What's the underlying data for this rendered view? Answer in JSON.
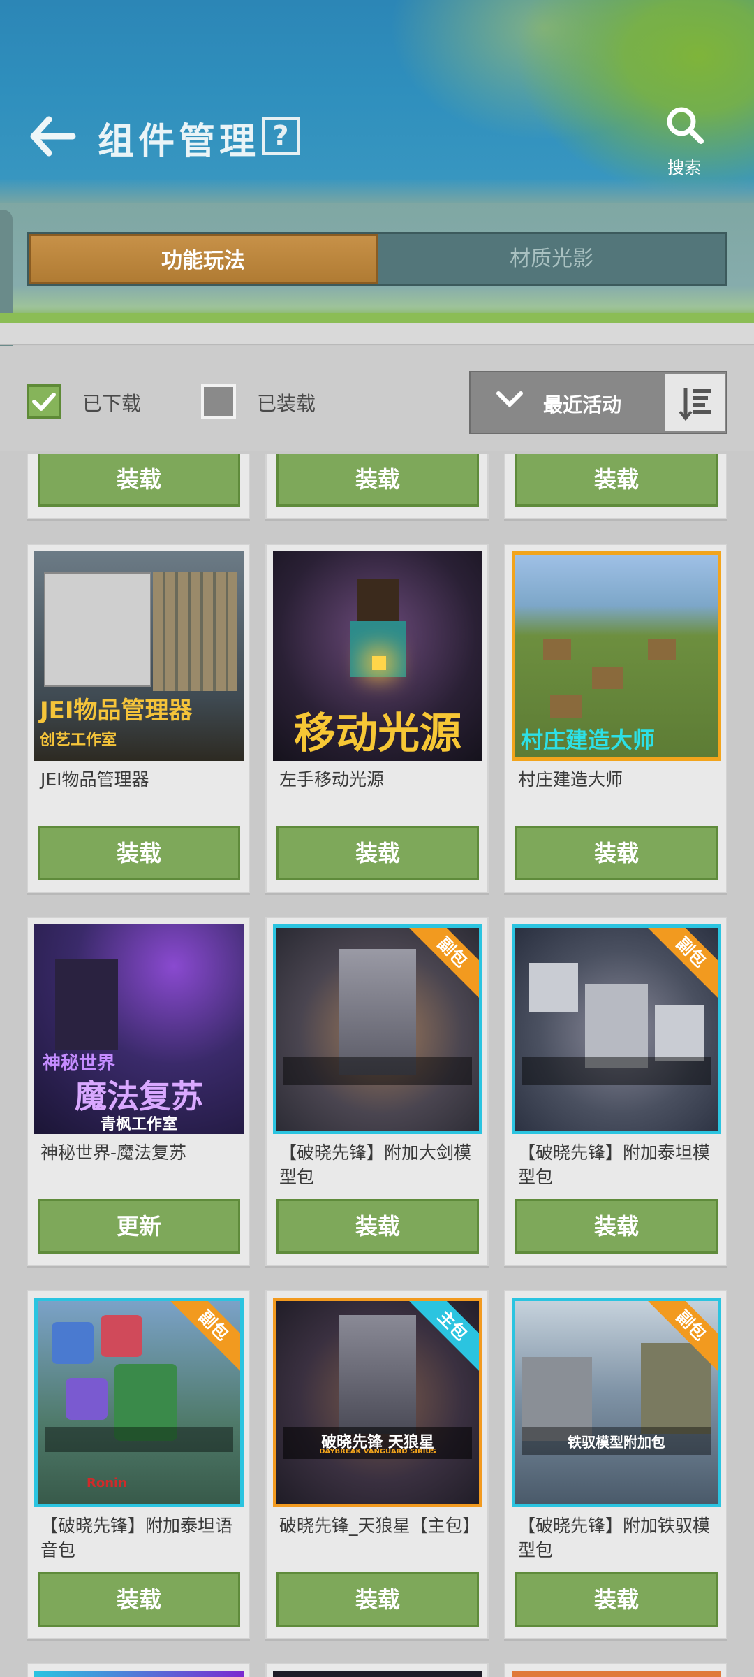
{
  "header": {
    "title": "组件管理",
    "help_label": "?",
    "search_label": "搜索"
  },
  "tabs": [
    {
      "label": "功能玩法",
      "active": true
    },
    {
      "label": "材质光影",
      "active": false
    }
  ],
  "filters": {
    "downloaded_label": "已下载",
    "downloaded_checked": true,
    "installed_label": "已装载",
    "installed_checked": false,
    "sort_label": "最近活动"
  },
  "cards": [
    {
      "name": "",
      "button": "装载"
    },
    {
      "name": "",
      "button": "装载"
    },
    {
      "name": "",
      "button": "装载"
    },
    {
      "name": "JEI物品管理器",
      "button": "装载",
      "thumb_title": "JEI物品管理器",
      "thumb_sub": "创艺工作室"
    },
    {
      "name": "左手移动光源",
      "button": "装载",
      "thumb_title": "移动光源"
    },
    {
      "name": "村庄建造大师",
      "button": "装载",
      "thumb_title": "村庄建造大师"
    },
    {
      "name": "神秘世界-魔法复苏",
      "button": "更新",
      "thumb_sub": "神秘世界",
      "thumb_title": "魔法复苏",
      "thumb_foot": "青枫工作室"
    },
    {
      "name": "【破晓先锋】附加大剑模型包",
      "button": "装载",
      "ribbon": "副包"
    },
    {
      "name": "【破晓先锋】附加泰坦模型包",
      "button": "装载",
      "ribbon": "副包"
    },
    {
      "name": "【破晓先锋】附加泰坦语音包",
      "button": "装载",
      "ribbon": "副包",
      "thumb_foot": "Ronin"
    },
    {
      "name": "破晓先锋_天狼星【主包】",
      "button": "装载",
      "ribbon": "主包",
      "thumb_title": "破晓先锋  天狼星",
      "thumb_sub": "DAYBREAK VANGUARD SIRIUS"
    },
    {
      "name": "【破晓先锋】附加铁驭模型包",
      "button": "装载",
      "ribbon": "副包",
      "thumb_title": "铁驭模型附加包"
    }
  ],
  "colors": {
    "accent_green": "#7ea85a",
    "tab_active": "#b98336",
    "ribbon_orange": "#f29a1f",
    "ribbon_cyan": "#2bc4e0"
  }
}
